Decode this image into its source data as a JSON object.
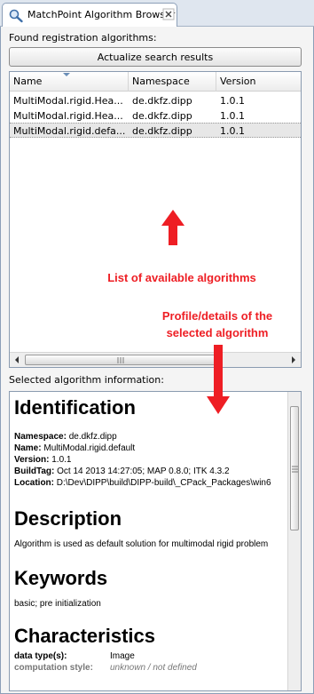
{
  "tab": {
    "title": "MatchPoint Algorithm Browser"
  },
  "found_label": "Found registration algorithms:",
  "actualize_button": "Actualize search results",
  "table": {
    "columns": [
      "Name",
      "Namespace",
      "Version"
    ],
    "rows": [
      {
        "name": "MultiModal.rigid.Hea...",
        "namespace": "de.dkfz.dipp",
        "version": "1.0.1",
        "selected": false
      },
      {
        "name": "MultiModal.rigid.Hea...",
        "namespace": "de.dkfz.dipp",
        "version": "1.0.1",
        "selected": false
      },
      {
        "name": "MultiModal.rigid.defa...",
        "namespace": "de.dkfz.dipp",
        "version": "1.0.1",
        "selected": true
      }
    ]
  },
  "selected_label": "Selected algorithm information:",
  "info": {
    "identification_heading": "Identification",
    "namespace_key": "Namespace:",
    "namespace_val": "de.dkfz.dipp",
    "name_key": "Name:",
    "name_val": "MultiModal.rigid.default",
    "version_key": "Version:",
    "version_val": "1.0.1",
    "buildtag_key": "BuildTag:",
    "buildtag_val": "Oct 14 2013 14:27:05; MAP 0.8.0; ITK 4.3.2",
    "location_key": "Location:",
    "location_val": "D:\\Dev\\DIPP\\build\\DIPP-build\\_CPack_Packages\\win6",
    "description_heading": "Description",
    "description_text": "Algorithm is used as default solution for multimodal rigid problem",
    "keywords_heading": "Keywords",
    "keywords_text": "basic; pre initialization",
    "characteristics_heading": "Characteristics",
    "datatype_key": "data type(s):",
    "datatype_val": "Image",
    "computation_key": "computation style:",
    "computation_val": "unknown / not defined"
  },
  "annotations": {
    "list_label": "List of available algorithms",
    "profile_label_1": "Profile/details of the",
    "profile_label_2": "selected algorithm"
  },
  "colors": {
    "annotation": "#ee1e24",
    "tab_bg": "#dfe6ef",
    "panel_bg": "#f4f4f4"
  }
}
